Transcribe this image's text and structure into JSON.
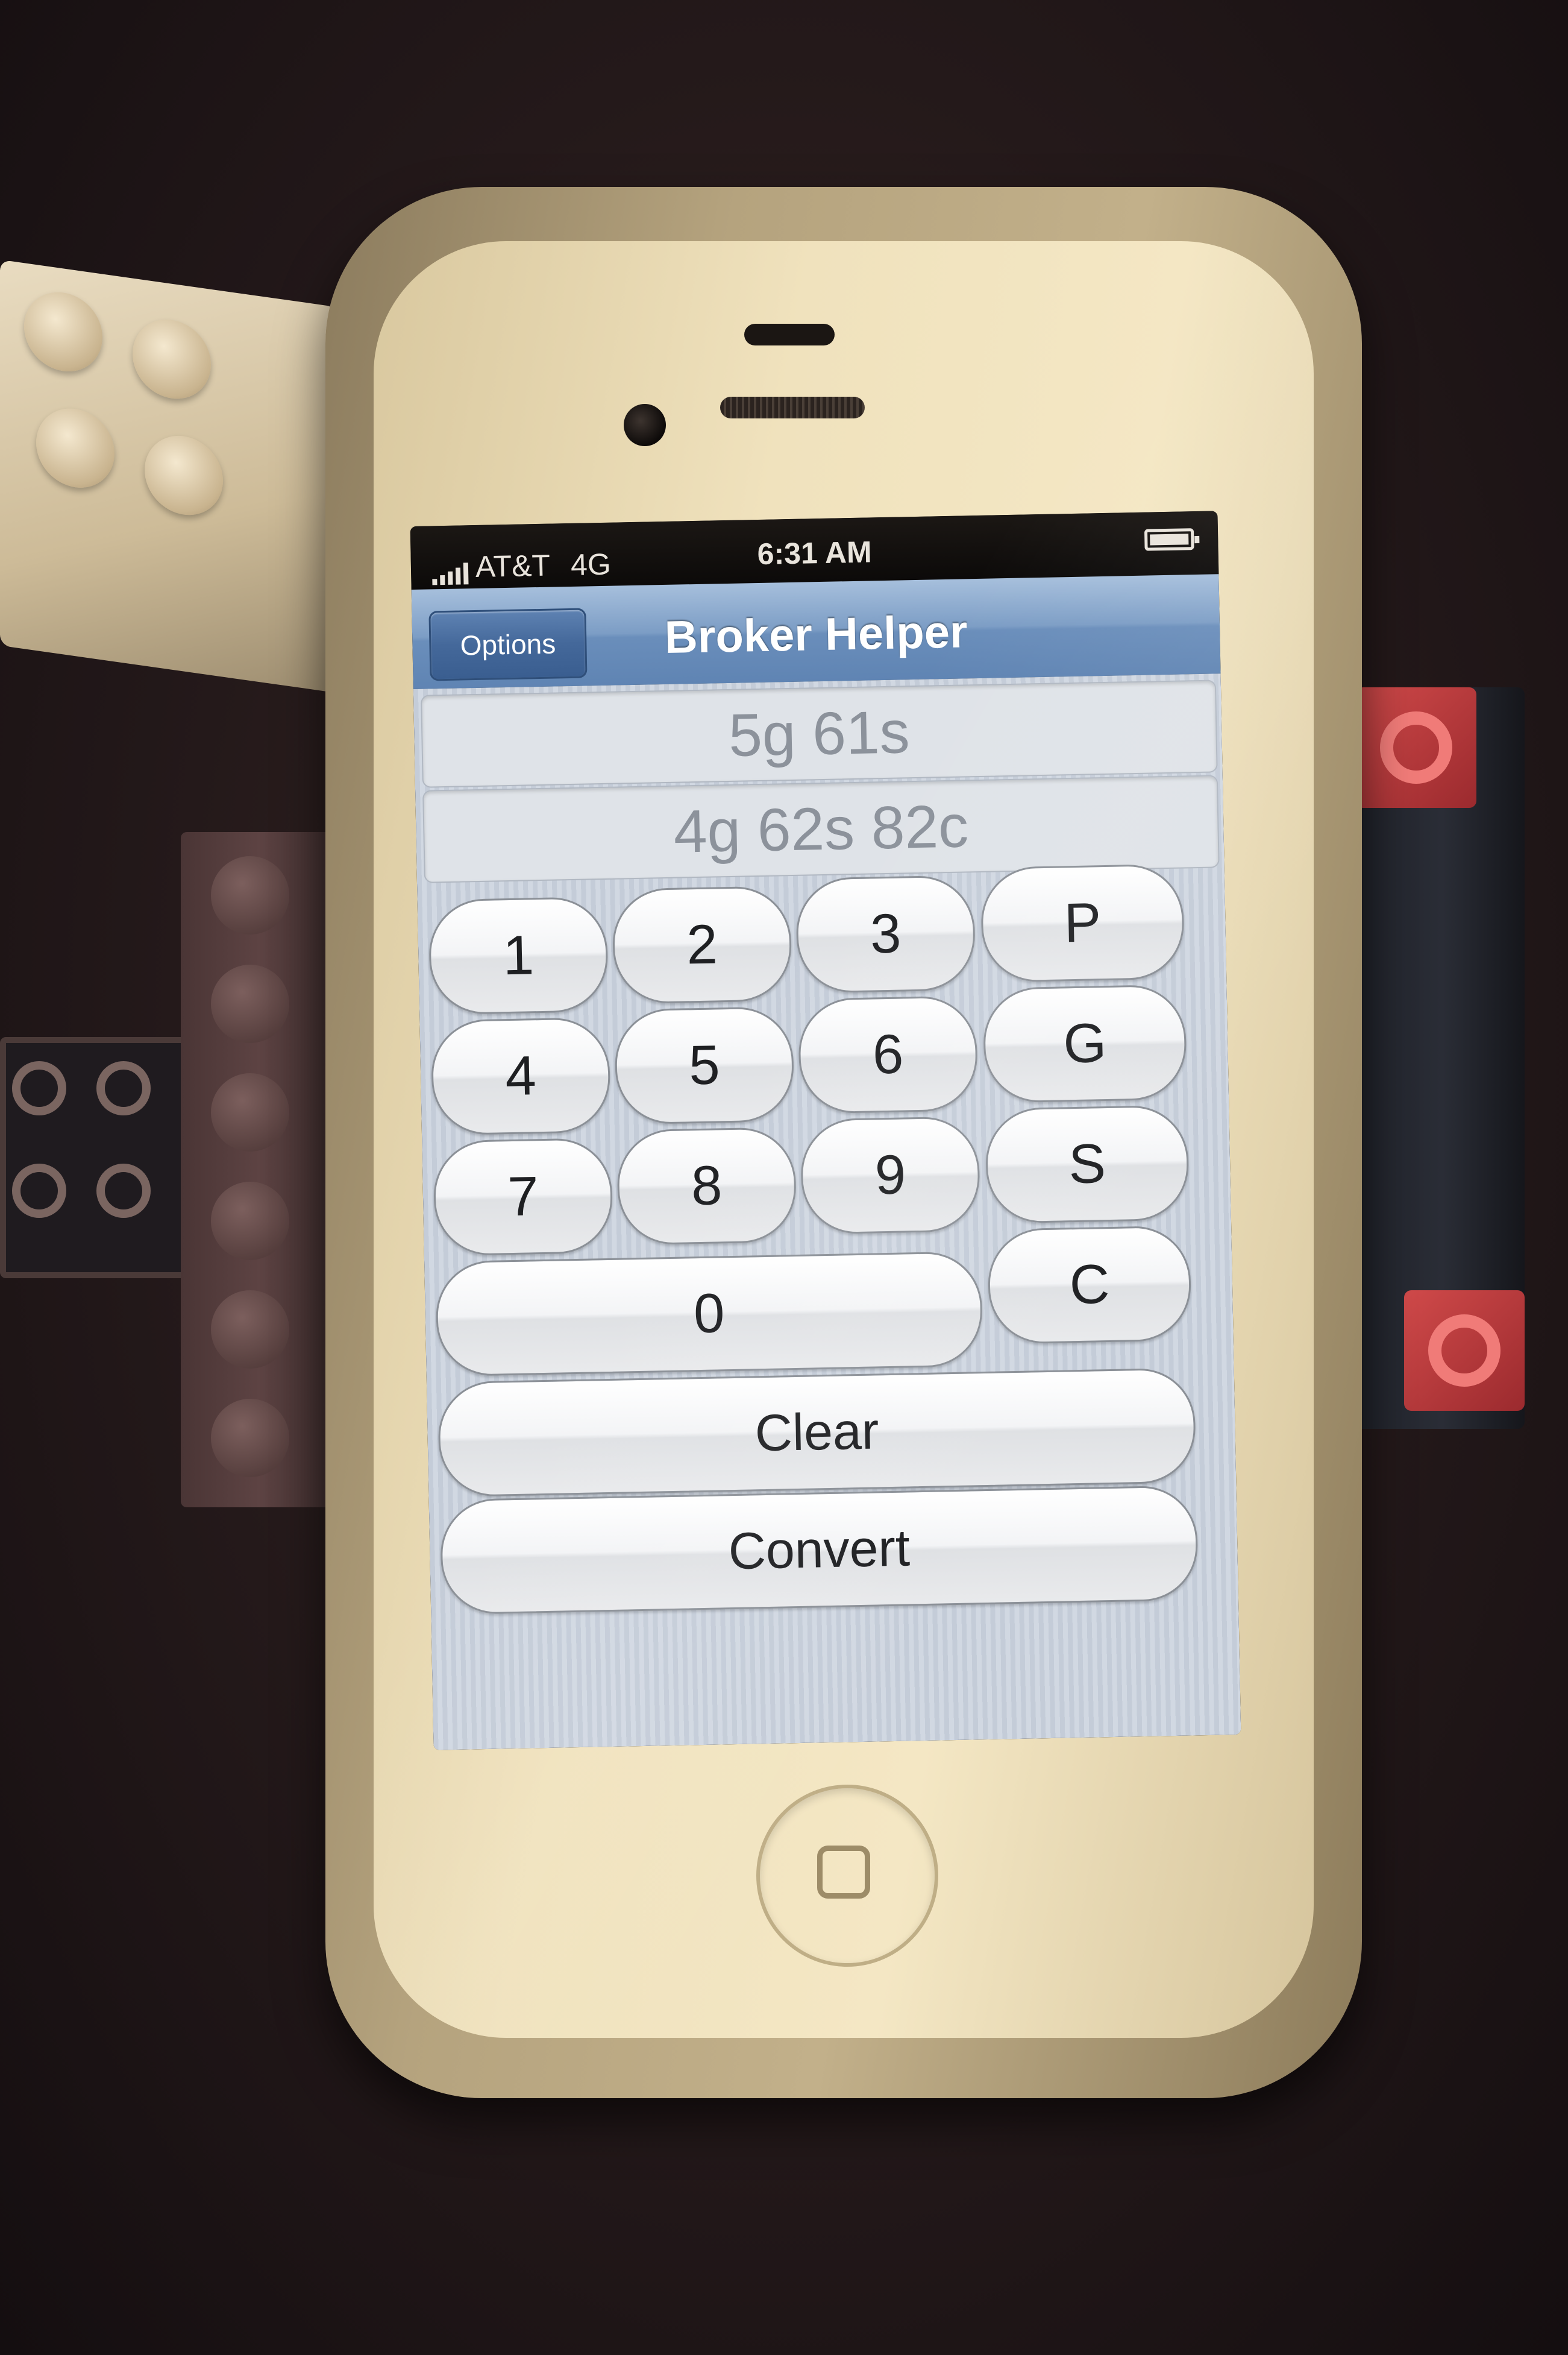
{
  "status_bar": {
    "carrier": "AT&T",
    "network": "4G",
    "time": "6:31 AM",
    "battery_icon": "battery-full-icon",
    "signal_icon": "signal-bars-icon"
  },
  "nav_bar": {
    "options_label": "Options",
    "title": "Broker Helper",
    "accent": "#6a8ebb"
  },
  "displays": {
    "input": "5g 61s",
    "output": "4g 62s 82c"
  },
  "keypad": {
    "row1": [
      "1",
      "2",
      "3",
      "P"
    ],
    "row2": [
      "4",
      "5",
      "6",
      "G"
    ],
    "row3": [
      "7",
      "8",
      "9",
      "S"
    ],
    "row4": [
      "0",
      "C"
    ],
    "clear_label": "Clear",
    "convert_label": "Convert"
  }
}
